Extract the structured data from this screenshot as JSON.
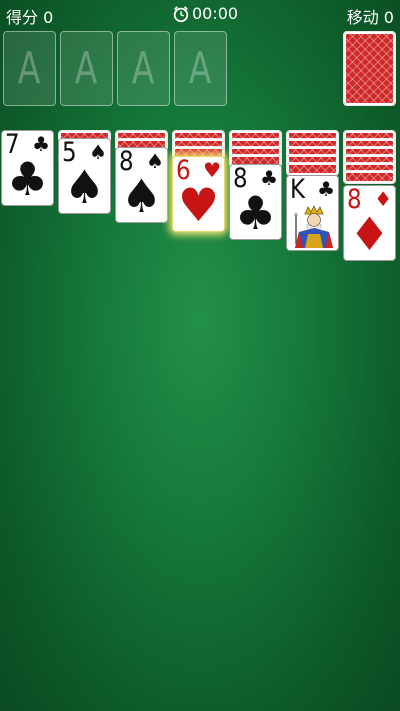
{
  "header": {
    "score": "得分 0",
    "timer": "00:00",
    "moves": "移动 0"
  },
  "foundations": [
    "A",
    "A",
    "A",
    "A"
  ],
  "tableau": [
    {
      "rank": "7",
      "suit": "♣",
      "color": "black"
    },
    {
      "rank": "5",
      "suit": "♠",
      "color": "black"
    },
    {
      "rank": "8",
      "suit": "♠",
      "color": "black"
    },
    {
      "rank": "6",
      "suit": "♥",
      "color": "red"
    },
    {
      "rank": "8",
      "suit": "♣",
      "color": "black"
    },
    {
      "rank": "K",
      "suit": "♣",
      "color": "black"
    },
    {
      "rank": "8",
      "suit": "♦",
      "color": "red"
    }
  ],
  "colors": {
    "felt": "#167a3b",
    "card_back": "#d02828",
    "red_suit": "#c71515",
    "highlight": "#fff078"
  }
}
